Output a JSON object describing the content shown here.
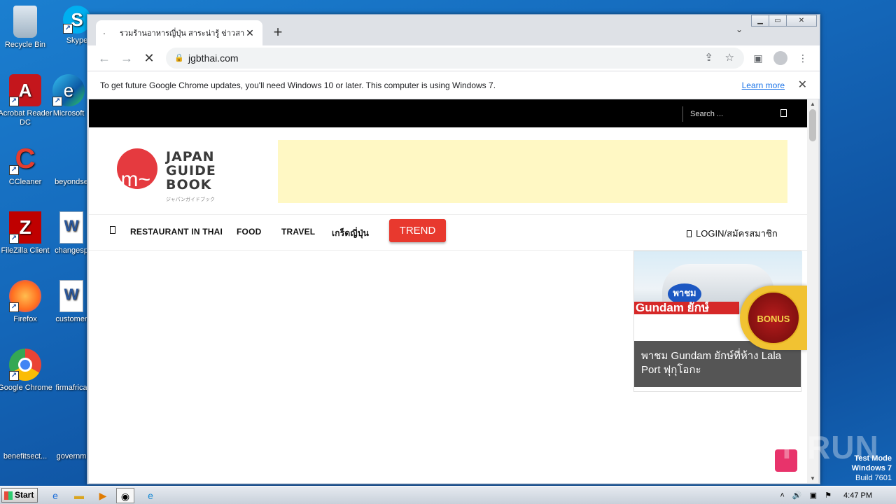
{
  "desktop": {
    "icons": [
      {
        "label": "Recycle Bin",
        "glyph": "🗑"
      },
      {
        "label": "Skype",
        "glyph": "S"
      },
      {
        "label": "Acrobat Reader DC",
        "glyph": "A"
      },
      {
        "label": "Microsoft",
        "glyph": "e"
      },
      {
        "label": "CCleaner",
        "glyph": "C"
      },
      {
        "label": "beyondse",
        "glyph": ""
      },
      {
        "label": "FileZilla Client",
        "glyph": "Z"
      },
      {
        "label": "changesp",
        "glyph": "W"
      },
      {
        "label": "Firefox",
        "glyph": "🦊"
      },
      {
        "label": "customer",
        "glyph": "W"
      },
      {
        "label": "Google Chrome",
        "glyph": "◉"
      },
      {
        "label": "firmafrica",
        "glyph": ""
      },
      {
        "label": "benefitsect...",
        "glyph": ""
      },
      {
        "label": "governm",
        "glyph": ""
      }
    ]
  },
  "browser": {
    "tab_title": "รวมร้านอาหารญี่ปุ่น สาระน่ารู้ ข่าวสาร ส",
    "url": "jgbthai.com",
    "infobar_text": "To get future Google Chrome updates, you'll need Windows 10 or later. This computer is using Windows 7.",
    "infobar_link": "Learn more"
  },
  "site": {
    "search_placeholder": "Search ...",
    "logo_lines": [
      "JAPAN",
      "GUIDE",
      "BOOK"
    ],
    "logo_sub": "ジャパンガイドブック",
    "menu": [
      "RESTAURANT IN THAI",
      "FOOD",
      "TRAVEL",
      "เกร็ดญี่ปุ่น"
    ],
    "trend": "TREND",
    "login": "LOGIN/สมัครสมาชิก",
    "card_badge": "พาชม",
    "card_banner": "Gundam ยักษ์",
    "card_caption": "พาชม Gundam ยักษ์ที่ห้าง Lala Port ฟุกุโอกะ",
    "bonus_label": "BONUS",
    "colors": {
      "accent": "#e8392e",
      "topbar": "#000000",
      "ad_bg": "#fff8c4"
    }
  },
  "overlay": {
    "watermark": "ANY RUN",
    "test_mode": [
      "Test Mode",
      "Windows 7",
      "Build 7601"
    ]
  },
  "taskbar": {
    "start": "Start",
    "clock": "4:47 PM"
  }
}
